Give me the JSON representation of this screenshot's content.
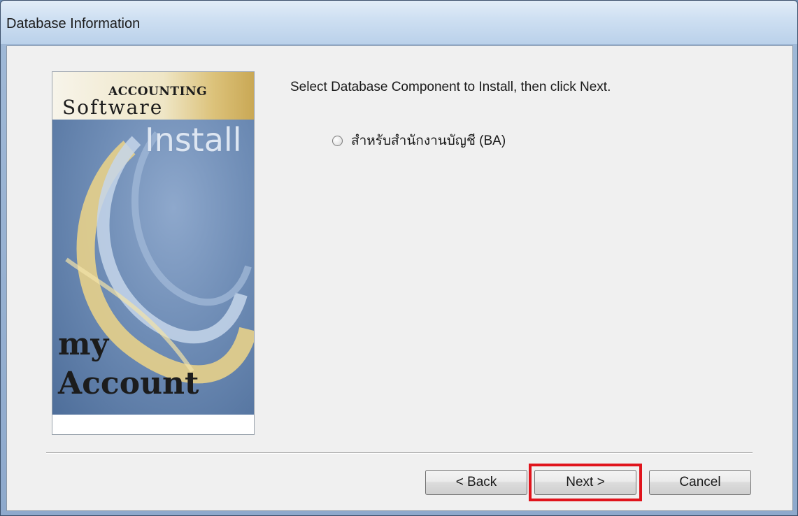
{
  "window": {
    "title": "Database Information"
  },
  "banner": {
    "line_accounting": "ACCOUNTING",
    "line_software": "Software",
    "line_install": "Install",
    "line_my": "my",
    "line_account": "Account"
  },
  "content": {
    "instruction": "Select Database Component to Install, then click Next.",
    "options": [
      {
        "label": "สำหรับสำนักงานบัญชี (BA)",
        "selected": false
      }
    ]
  },
  "buttons": {
    "back": "< Back",
    "next": "Next >",
    "cancel": "Cancel"
  },
  "colors": {
    "highlight": "#e0141c"
  }
}
